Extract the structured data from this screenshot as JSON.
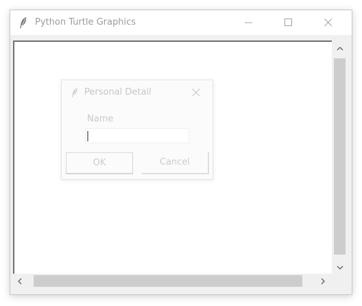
{
  "window": {
    "title": "Python Turtle Graphics",
    "icon": "feather-icon",
    "controls": [
      "minimize-icon",
      "maximize-icon",
      "close-icon"
    ]
  },
  "dialog": {
    "title": "Personal Detail",
    "icon": "feather-icon",
    "field_label": "Name",
    "field_value": "",
    "ok_label": "OK",
    "cancel_label": "Cancel"
  },
  "colors": {
    "title_text": "#9b9b9b",
    "dialog_text": "#c6c6c6",
    "scroll_thumb": "#cdcdcd"
  }
}
